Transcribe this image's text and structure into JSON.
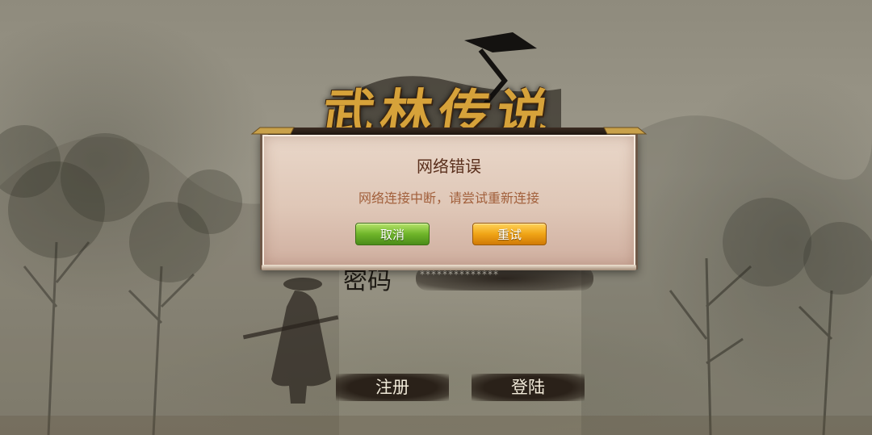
{
  "logo": {
    "text": "武林传说"
  },
  "password_row": {
    "label": "密码",
    "mask": "**************"
  },
  "dialog": {
    "title": "网络错误",
    "message": "网络连接中断，请尝试重新连接",
    "cancel_label": "取消",
    "retry_label": "重试"
  },
  "bottom_buttons": {
    "register_label": "注册",
    "login_label": "登陆"
  },
  "colors": {
    "dialog_bg": "#e5d1c2",
    "title": "#5a2f1c",
    "message": "#a2603c",
    "cancel_button": "#6fb52a",
    "retry_button": "#f0a416"
  }
}
